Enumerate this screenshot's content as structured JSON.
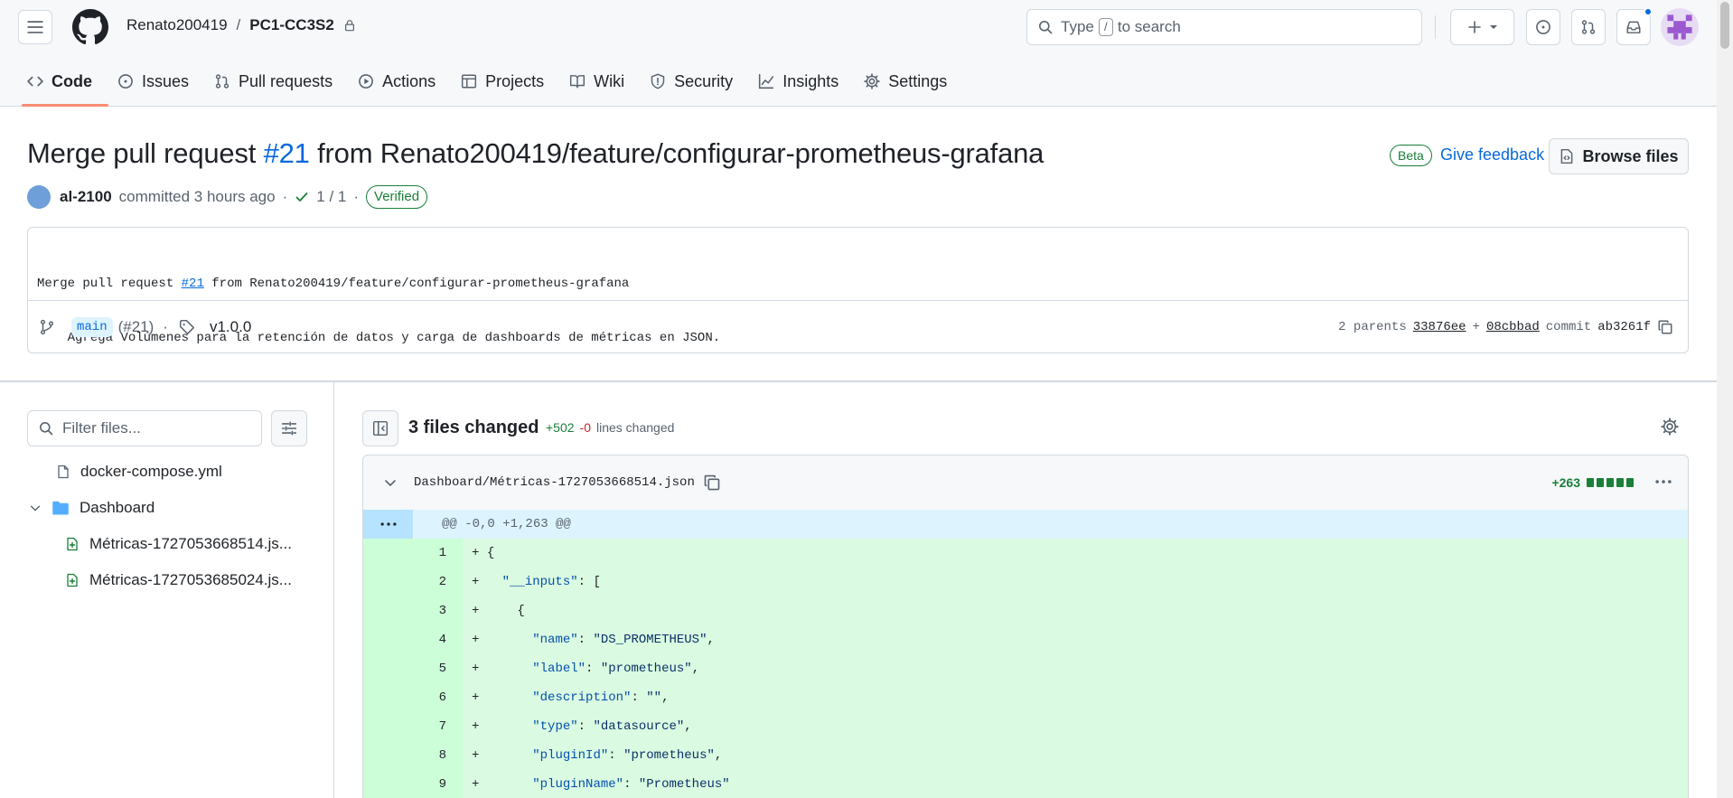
{
  "header": {
    "owner": "Renato200419",
    "separator": "/",
    "repo": "PC1-CC3S2",
    "search_placeholder_prefix": "Type",
    "search_key": "/",
    "search_placeholder_suffix": "to search",
    "notification_dot_color": "#0969da"
  },
  "tabs": [
    {
      "label": "Code",
      "icon": "code-icon",
      "active": true
    },
    {
      "label": "Issues",
      "icon": "issue-icon"
    },
    {
      "label": "Pull requests",
      "icon": "pull-request-icon"
    },
    {
      "label": "Actions",
      "icon": "play-icon"
    },
    {
      "label": "Projects",
      "icon": "table-icon"
    },
    {
      "label": "Wiki",
      "icon": "book-icon"
    },
    {
      "label": "Security",
      "icon": "shield-icon"
    },
    {
      "label": "Insights",
      "icon": "graph-icon"
    },
    {
      "label": "Settings",
      "icon": "gear-icon"
    }
  ],
  "commit": {
    "title_prefix": "Merge pull request",
    "pr_ref": "#21",
    "title_suffix": "from Renato200419/feature/configurar-prometheus-grafana",
    "beta_label": "Beta",
    "feedback_label": "Give feedback",
    "browse_label": "Browse files",
    "author": "al-2100",
    "committed_text": "committed 3 hours ago",
    "dot": "·",
    "checks": "1 / 1",
    "verified": "Verified",
    "message_prefix": "Merge pull request ",
    "message_pr": "#21",
    "message_suffix": " from Renato200419/feature/configurar-prometheus-grafana",
    "message_body": "Agrega Volúmenes para la retención de datos y carga de dashboards de métricas en JSON.",
    "branch": "main",
    "branch_pr": "(#21)",
    "tag": "v1.0.0",
    "parents_label": "2 parents",
    "parent_1": "33876ee",
    "plus": "+",
    "parent_2": "08cbbad",
    "commit_label": "commit",
    "sha": "ab3261f"
  },
  "sidebar": {
    "filter_placeholder": "Filter files...",
    "items": [
      {
        "label": "docker-compose.yml",
        "icon": "file-icon"
      },
      {
        "label": "Dashboard",
        "icon": "folder-icon"
      },
      {
        "label": "Métricas-1727053668514.js...",
        "icon": "file-added-icon"
      },
      {
        "label": "Métricas-1727053685024.js...",
        "icon": "file-added-icon"
      }
    ]
  },
  "diff": {
    "files_changed": "3 files changed",
    "additions": "+502",
    "deletions": "-0",
    "lines_changed": "lines changed",
    "file_name": "Dashboard/Métricas-1727053668514.json",
    "file_additions": "+263",
    "hunk": "@@ -0,0 +1,263 @@",
    "lines": [
      {
        "n": "1",
        "indent": "",
        "key": "",
        "rest": "{"
      },
      {
        "n": "2",
        "indent": "  ",
        "key": "\"__inputs\"",
        "rest": ": ["
      },
      {
        "n": "3",
        "indent": "    ",
        "key": "",
        "rest": "{"
      },
      {
        "n": "4",
        "indent": "      ",
        "key": "\"name\"",
        "rest": ": ",
        "val": "\"DS_PROMETHEUS\"",
        "tail": ","
      },
      {
        "n": "5",
        "indent": "      ",
        "key": "\"label\"",
        "rest": ": ",
        "val": "\"prometheus\"",
        "tail": ","
      },
      {
        "n": "6",
        "indent": "      ",
        "key": "\"description\"",
        "rest": ": ",
        "val": "\"\"",
        "tail": ","
      },
      {
        "n": "7",
        "indent": "      ",
        "key": "\"type\"",
        "rest": ": ",
        "val": "\"datasource\"",
        "tail": ","
      },
      {
        "n": "8",
        "indent": "      ",
        "key": "\"pluginId\"",
        "rest": ": ",
        "val": "\"prometheus\"",
        "tail": ","
      },
      {
        "n": "9",
        "indent": "      ",
        "key": "\"pluginName\"",
        "rest": ": ",
        "val": "\"Prometheus\"",
        "tail": ""
      }
    ]
  }
}
